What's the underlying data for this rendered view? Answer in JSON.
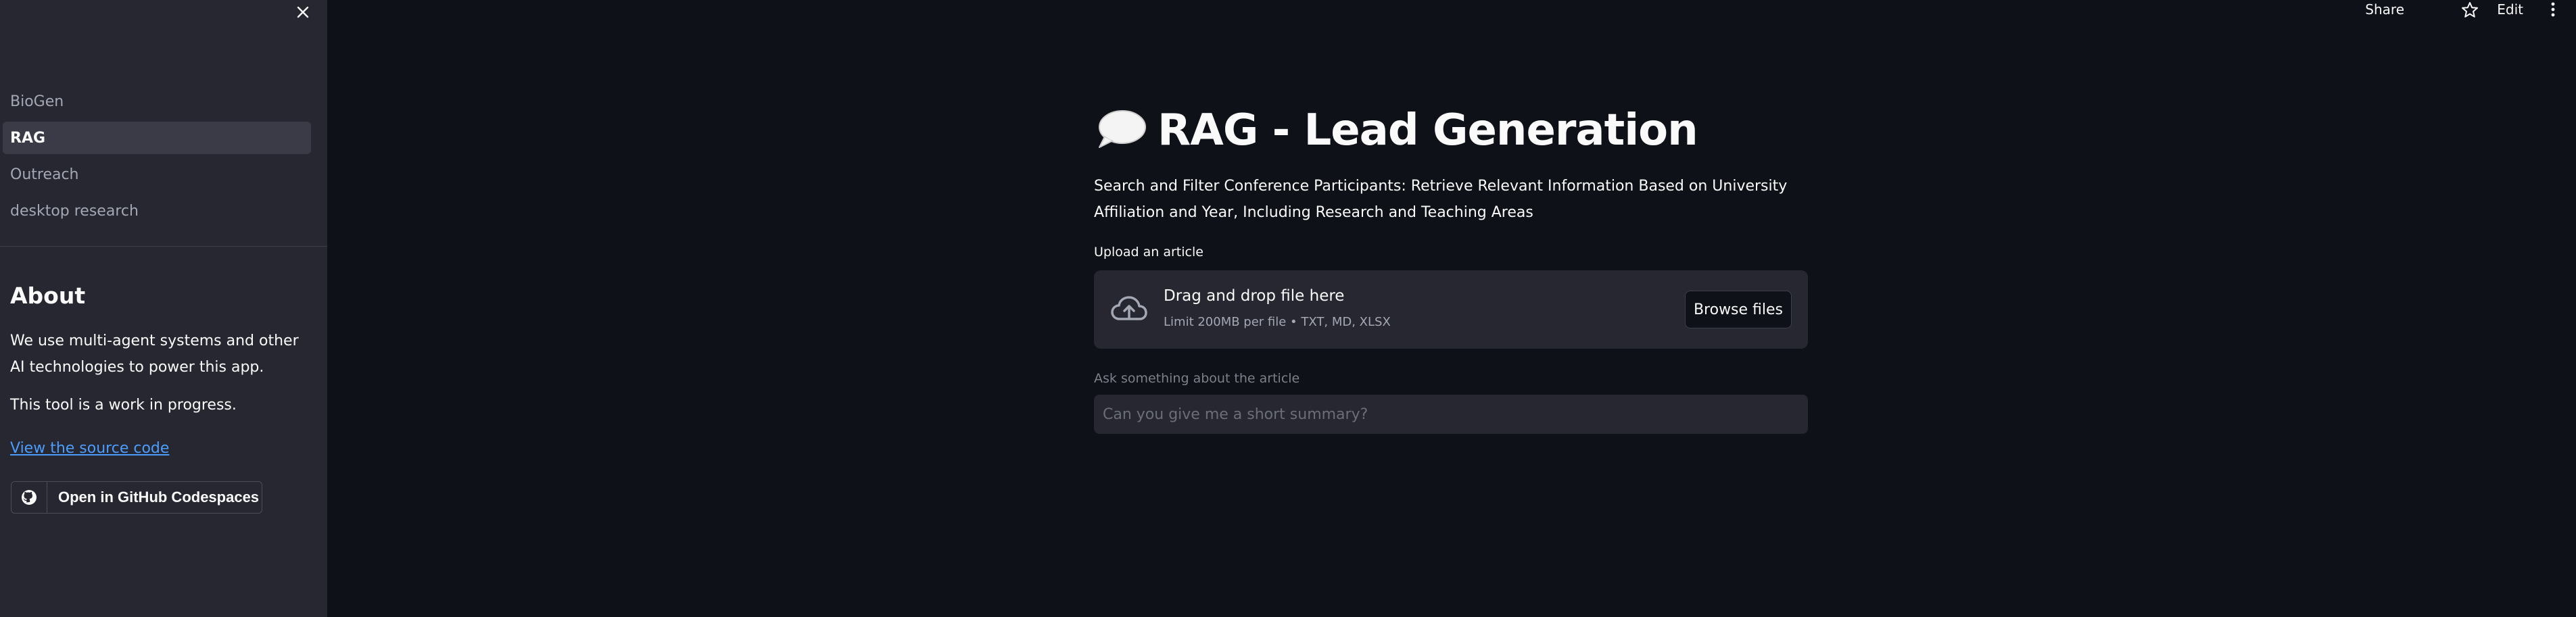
{
  "sidebar": {
    "close_icon": "close-icon",
    "nav": [
      {
        "label": "BioGen",
        "active": false
      },
      {
        "label": "RAG",
        "active": true
      },
      {
        "label": "Outreach",
        "active": false
      },
      {
        "label": "desktop research",
        "active": false
      }
    ],
    "about": {
      "title": "About",
      "text1": "We use multi-agent systems and other AI technologies to power this app.",
      "text2": "This tool is a work in progress.",
      "link": "View the source code"
    },
    "codespaces_button": "Open in GitHub Codespaces"
  },
  "toolbar": {
    "share": "Share",
    "edit": "Edit",
    "star_icon": "star-icon",
    "menu_icon": "more-vertical-icon"
  },
  "main": {
    "title_icon": "speech-balloon-icon",
    "title": "RAG - Lead Generation",
    "subtitle": "Search and Filter Conference Participants: Retrieve Relevant Information Based on University Affiliation and Year, Including Research and Teaching Areas",
    "upload": {
      "label": "Upload an article",
      "drop_text": "Drag and drop file here",
      "limit_text": "Limit 200MB per file • TXT, MD, XLSX",
      "browse_label": "Browse files"
    },
    "ask": {
      "label": "Ask something about the article",
      "placeholder": "Can you give me a short summary?"
    }
  },
  "colors": {
    "background": "#0e1117",
    "sidebar": "#262730",
    "link": "#4b9dff"
  }
}
